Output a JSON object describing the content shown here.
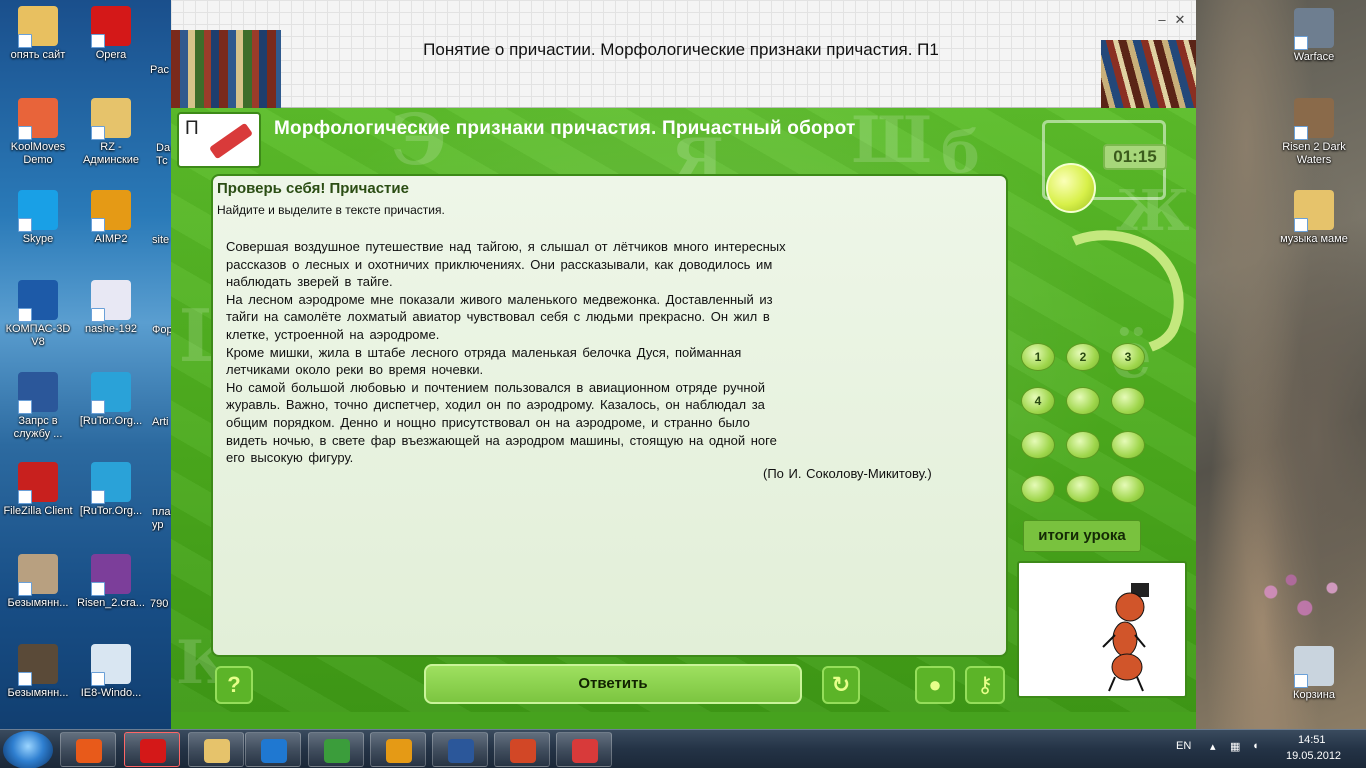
{
  "desktop": {
    "left_icons": [
      {
        "label": "опять сайт",
        "color": "#e8c060"
      },
      {
        "label": "Opera",
        "color": "#d41818"
      },
      {
        "label": "KoolMoves Demo",
        "color": "#e8643a"
      },
      {
        "label": "RZ - Админские",
        "color": "#e6c36b"
      },
      {
        "label": "Skype",
        "color": "#19a0e6"
      },
      {
        "label": "AIMP2",
        "color": "#e59a15"
      },
      {
        "label": "КОМПАС-3D V8",
        "color": "#1d5aa8"
      },
      {
        "label": "nashe-192",
        "color": "#e8e8f4"
      },
      {
        "label": "Запрс в службу ...",
        "color": "#2b579a"
      },
      {
        "label": "[RuTor.Org...",
        "color": "#2aa2d8"
      },
      {
        "label": "FileZilla Client",
        "color": "#c8201e"
      },
      {
        "label": "[RuTor.Org...",
        "color": "#2aa2d8"
      },
      {
        "label": "Безымянн...",
        "color": "#b8a080"
      },
      {
        "label": "Risen_2.cra...",
        "color": "#7c3e9a"
      },
      {
        "label": "Безымянн...",
        "color": "#5a4a38"
      },
      {
        "label": "IE8-Windo...",
        "color": "#d9e6f2"
      }
    ],
    "partial_icons": [
      "Pac",
      "Dа Тс",
      "site",
      "Фор",
      "Arti",
      "пла ур",
      "790"
    ],
    "right_icons": [
      {
        "label": "Warface",
        "color": "#6e7e90"
      },
      {
        "label": "Risen 2 Dark Waters",
        "color": "#8a6a4a"
      },
      {
        "label": "музыка маме",
        "color": "#e6c36b"
      },
      {
        "label": "Корзина",
        "color": "#c9d4de"
      }
    ]
  },
  "window": {
    "title": "Понятие о причастии. Морфологические признаки причастия. П1",
    "minimize": "–",
    "close": "✕"
  },
  "lesson": {
    "logo_letter": "П",
    "header": "Морфологические признаки причастия. Причастный оборот",
    "panel_title": "Проверь себя! Причастие",
    "instruction": "Найдите и выделите в тексте причастия.",
    "text_lines": [
      "Совершая воздушное путешествие над тайгою, я слышал от лётчиков много интересных",
      "рассказов о лесных и охотничих приключениях. Они рассказывали, как доводилось им",
      "наблюдать зверей в тайге.",
      "На лесном аэродроме мне показали живого маленького медвежонка. Доставленный из",
      "тайги на самолёте лохматый авиатор чувствовал себя с людьми прекрасно. Он жил в",
      "клетке, устроенной на аэродроме.",
      "Кроме мишки, жила в штабе лесного отряда маленькая белочка Дуся, пойманная",
      "летчиками около реки во время ночевки.",
      "Но самой большой любовью и почтением пользовался в авиационном отряде ручной",
      "журавль. Важно, точно диспетчер, ходил он по аэродрому. Казалось, он наблюдал за",
      "общим порядком. Денно и нощно присутствовал он на аэродроме, и странно было",
      "видеть ночью, в свете фар въезжающей на аэродром машины, стоящую на одной ноге",
      "его высокую фигуру."
    ],
    "author": "(По И. Соколову-Микитову.)",
    "timer": "01:15",
    "keypad": [
      "1",
      "2",
      "3",
      "4",
      "",
      "",
      "",
      "",
      "",
      "",
      "",
      ""
    ],
    "summary_button": "итоги урока",
    "help_button": "?",
    "answer_button": "Ответить",
    "colors": {
      "accent_green": "#4aa91c",
      "panel_bg": "#e9f3e1",
      "title_dark_green": "#2b4d14"
    }
  },
  "taskbar": {
    "apps": [
      {
        "name": "media-player",
        "color": "#e85a1a"
      },
      {
        "name": "opera",
        "color": "#d41818"
      },
      {
        "name": "explorer",
        "color": "#e6c36b"
      },
      {
        "name": "internet-explorer",
        "color": "#1f78d1"
      },
      {
        "name": "chrome",
        "color": "#3b9d3b"
      },
      {
        "name": "aimp",
        "color": "#e59a15"
      },
      {
        "name": "word",
        "color": "#2b579a"
      },
      {
        "name": "powerpoint",
        "color": "#d24726"
      },
      {
        "name": "upload-app",
        "color": "#d83a3a"
      }
    ],
    "lang": "EN",
    "time": "14:51",
    "date": "19.05.2012"
  }
}
